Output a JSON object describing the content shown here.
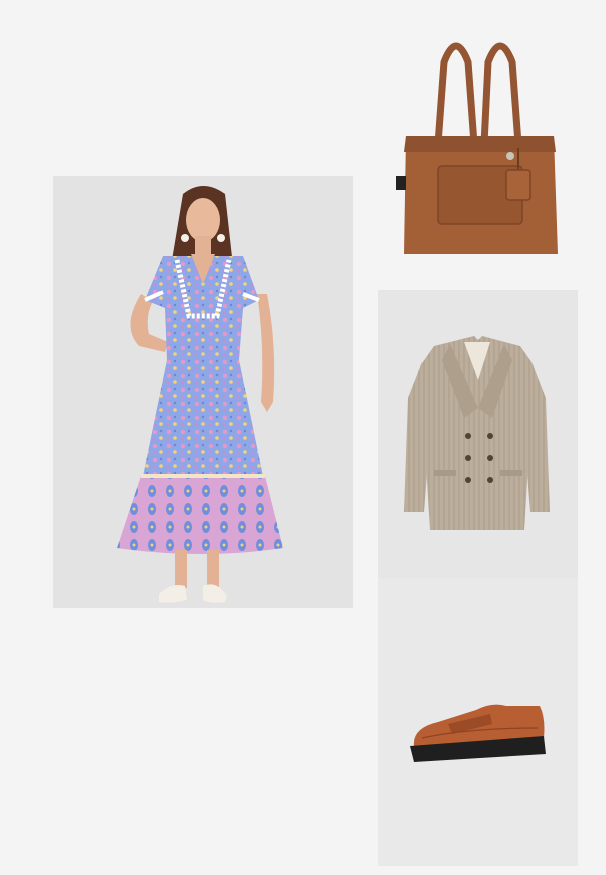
{
  "board": {
    "background": "#f4f4f4",
    "items": [
      {
        "name": "dress-photo",
        "icon": "floral-maxi-dress",
        "colors": {
          "base": "#8ea6e4",
          "hem": "#d9a6d4",
          "trim": "#ffffff"
        }
      },
      {
        "name": "handbag-photo",
        "icon": "tote-bag",
        "colors": {
          "leather": "#a35f36"
        }
      },
      {
        "name": "blazer-photo",
        "icon": "double-breasted-blazer",
        "colors": {
          "fabric": "#b9ab99"
        }
      },
      {
        "name": "loafer-photo",
        "icon": "penny-loafer",
        "colors": {
          "leather": "#b85e33",
          "sole": "#1f1f1f"
        }
      }
    ]
  }
}
